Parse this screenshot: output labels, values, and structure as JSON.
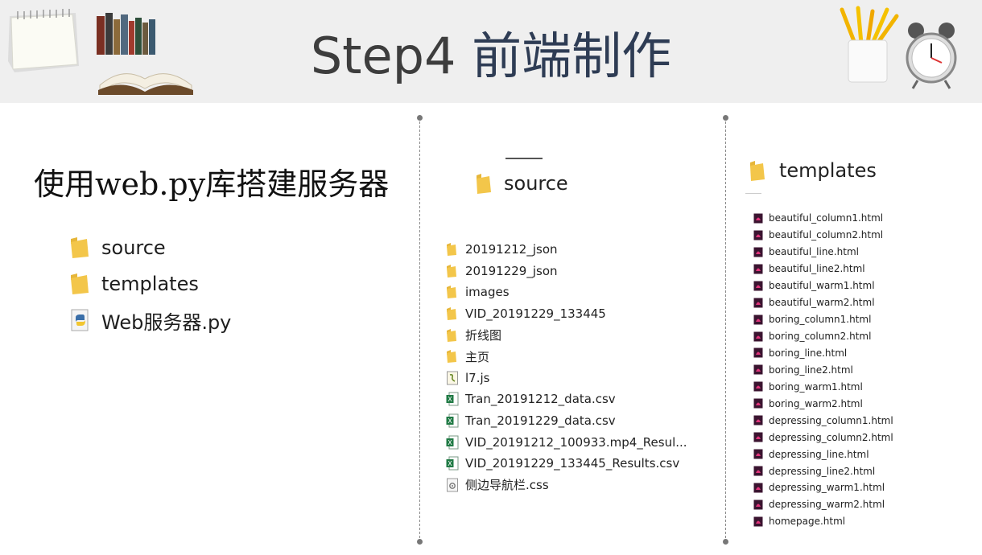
{
  "header": {
    "title_en": "Step4",
    "title_cn": "前端制作"
  },
  "left": {
    "subtitle": "使用web.py库搭建服务器",
    "items": [
      {
        "icon": "folder-icon",
        "label": "source"
      },
      {
        "icon": "folder-icon",
        "label": "templates"
      },
      {
        "icon": "python-file-icon",
        "label": "Web服务器.py"
      }
    ]
  },
  "middle": {
    "folder_label": "source",
    "items": [
      {
        "icon": "folder-icon",
        "label": "20191212_json"
      },
      {
        "icon": "folder-icon",
        "label": "20191229_json"
      },
      {
        "icon": "folder-icon",
        "label": "images"
      },
      {
        "icon": "folder-icon",
        "label": "VID_20191229_133445"
      },
      {
        "icon": "folder-icon",
        "label": "折线图"
      },
      {
        "icon": "folder-icon",
        "label": "主页"
      },
      {
        "icon": "js-file-icon",
        "label": "l7.js"
      },
      {
        "icon": "excel-file-icon",
        "label": "Tran_20191212_data.csv"
      },
      {
        "icon": "excel-file-icon",
        "label": "Tran_20191229_data.csv"
      },
      {
        "icon": "excel-file-icon",
        "label": "VID_20191212_100933.mp4_Resul..."
      },
      {
        "icon": "excel-file-icon",
        "label": "VID_20191229_133445_Results.csv"
      },
      {
        "icon": "css-file-icon",
        "label": "侧边导航栏.css"
      }
    ]
  },
  "right": {
    "folder_label": "templates",
    "items": [
      {
        "icon": "html-file-icon",
        "label": "beautiful_column1.html"
      },
      {
        "icon": "html-file-icon",
        "label": "beautiful_column2.html"
      },
      {
        "icon": "html-file-icon",
        "label": "beautiful_line.html"
      },
      {
        "icon": "html-file-icon",
        "label": "beautiful_line2.html"
      },
      {
        "icon": "html-file-icon",
        "label": "beautiful_warm1.html"
      },
      {
        "icon": "html-file-icon",
        "label": "beautiful_warm2.html"
      },
      {
        "icon": "html-file-icon",
        "label": "boring_column1.html"
      },
      {
        "icon": "html-file-icon",
        "label": "boring_column2.html"
      },
      {
        "icon": "html-file-icon",
        "label": "boring_line.html"
      },
      {
        "icon": "html-file-icon",
        "label": "boring_line2.html"
      },
      {
        "icon": "html-file-icon",
        "label": "boring_warm1.html"
      },
      {
        "icon": "html-file-icon",
        "label": "boring_warm2.html"
      },
      {
        "icon": "html-file-icon",
        "label": "depressing_column1.html"
      },
      {
        "icon": "html-file-icon",
        "label": "depressing_column2.html"
      },
      {
        "icon": "html-file-icon",
        "label": "depressing_line.html"
      },
      {
        "icon": "html-file-icon",
        "label": "depressing_line2.html"
      },
      {
        "icon": "html-file-icon",
        "label": "depressing_warm1.html"
      },
      {
        "icon": "html-file-icon",
        "label": "depressing_warm2.html"
      },
      {
        "icon": "html-file-icon",
        "label": "homepage.html"
      }
    ]
  },
  "colors": {
    "header_bg": "#efefef",
    "title_en": "#3d3d3d",
    "title_cn": "#2e3c54",
    "folder": "#f3c64a",
    "excel": "#1f7a44",
    "html_icon": "#b0205a"
  }
}
